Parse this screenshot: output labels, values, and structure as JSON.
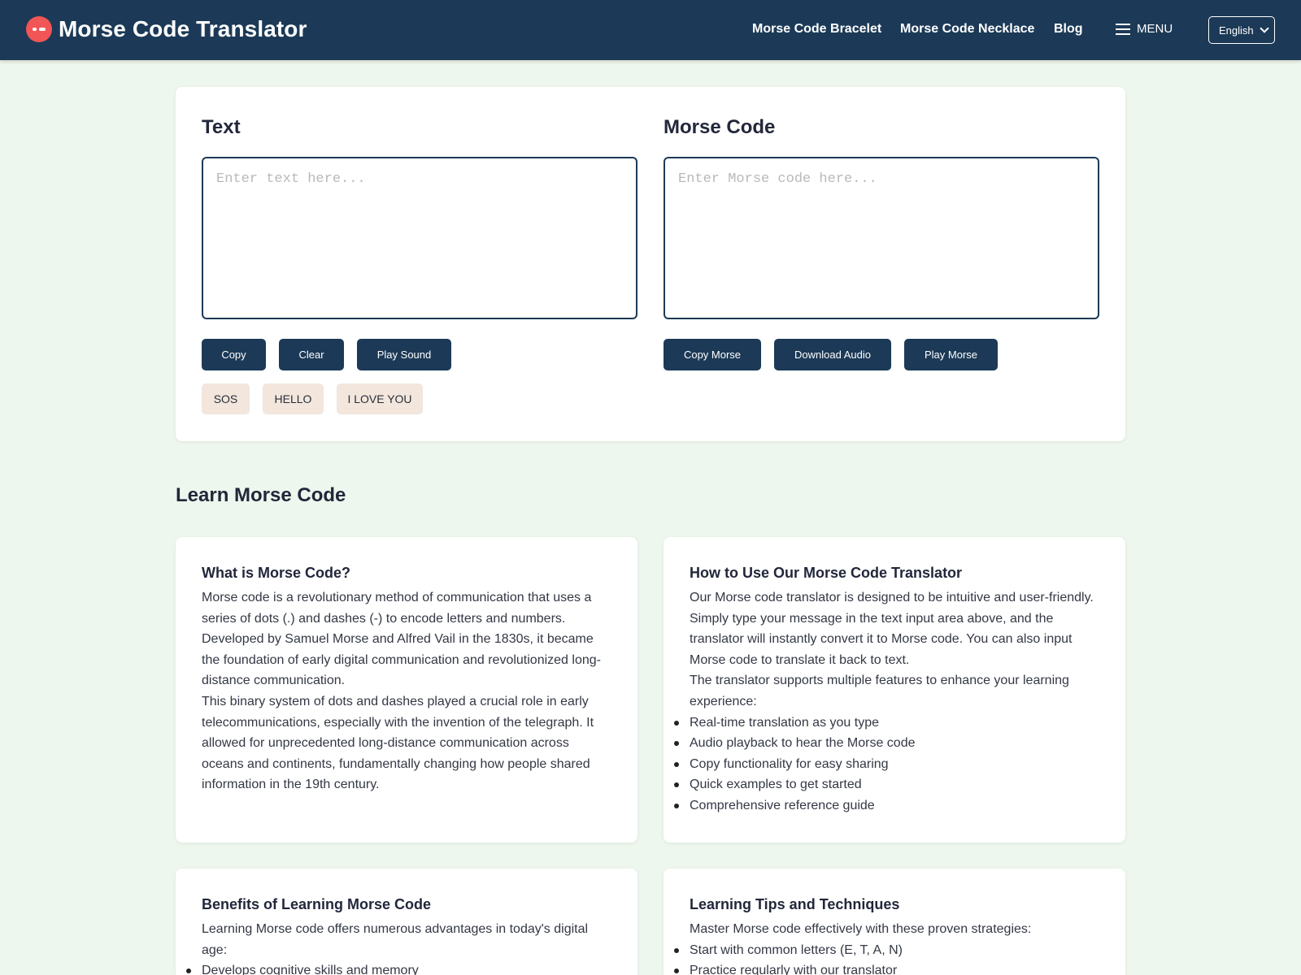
{
  "header": {
    "brand": "Morse Code Translator",
    "nav": [
      "Morse Code Bracelet",
      "Morse Code Necklace",
      "Blog"
    ],
    "menu_label": "MENU",
    "language": "English"
  },
  "translator": {
    "text_title": "Text",
    "text_placeholder": "Enter text here...",
    "morse_title": "Morse Code",
    "morse_placeholder": "Enter Morse code here...",
    "text_buttons": [
      "Copy",
      "Clear",
      "Play Sound"
    ],
    "morse_buttons": [
      "Copy Morse",
      "Download Audio",
      "Play Morse"
    ],
    "examples": [
      "SOS",
      "HELLO",
      "I LOVE YOU"
    ]
  },
  "learn": {
    "section_title": "Learn Morse Code",
    "what_is": {
      "title": "What is Morse Code?",
      "p1": "Morse code is a revolutionary method of communication that uses a series of dots (.) and dashes (-) to encode letters and numbers. Developed by Samuel Morse and Alfred Vail in the 1830s, it became the foundation of early digital communication and revolutionized long-distance communication.",
      "p2": "This binary system of dots and dashes played a crucial role in early telecommunications, especially with the invention of the telegraph. It allowed for unprecedented long-distance communication across oceans and continents, fundamentally changing how people shared information in the 19th century."
    },
    "how_to": {
      "title": "How to Use Our Morse Code Translator",
      "p1": "Our Morse code translator is designed to be intuitive and user-friendly. Simply type your message in the text input area above, and the translator will instantly convert it to Morse code. You can also input Morse code to translate it back to text.",
      "p2": "The translator supports multiple features to enhance your learning experience:",
      "items": [
        "Real-time translation as you type",
        "Audio playback to hear the Morse code",
        "Copy functionality for easy sharing",
        "Quick examples to get started",
        "Comprehensive reference guide"
      ]
    },
    "benefits": {
      "title": "Benefits of Learning Morse Code",
      "p1": "Learning Morse code offers numerous advantages in today's digital age:",
      "items": [
        "Develops cognitive skills and memory"
      ]
    },
    "tips": {
      "title": "Learning Tips and Techniques",
      "p1": "Master Morse code effectively with these proven strategies:",
      "items": [
        "Start with common letters (E, T, A, N)",
        "Practice regularly with our translator"
      ]
    }
  }
}
